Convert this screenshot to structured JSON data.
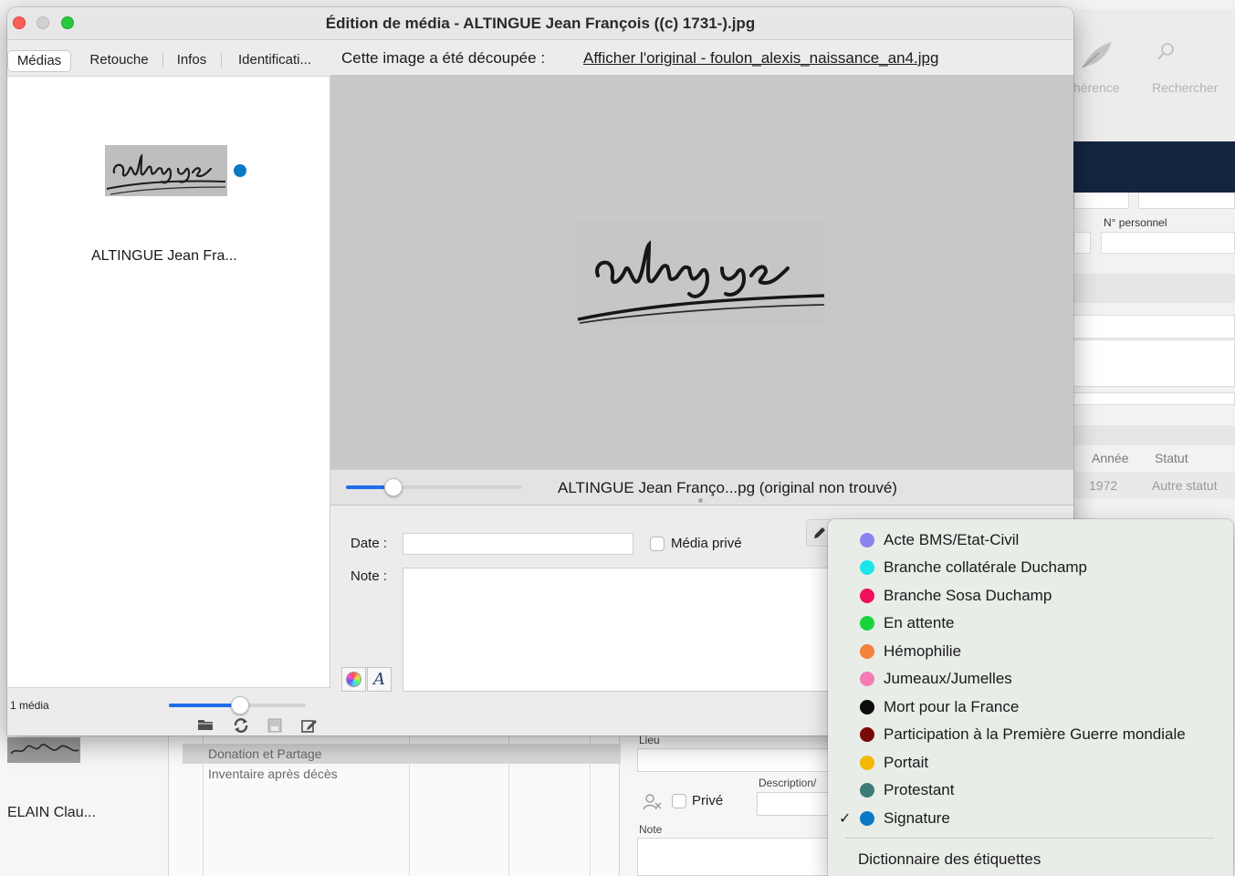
{
  "window": {
    "title": "Édition de média - ALTINGUE Jean François ((c) 1731-).jpg"
  },
  "tabs": [
    "Médias",
    "Retouche",
    "Infos",
    "Identificati..."
  ],
  "left_panel": {
    "thumbnail_name": "ALTINGUE Jean Fra...",
    "media_count": "1 média",
    "zoom_fraction": 0.52
  },
  "crop": {
    "label": "Cette image a été découpée :",
    "link": "Afficher l'original - foulon_alexis_naissance_an4.jpg"
  },
  "viewer": {
    "caption": "ALTINGUE Jean Franço...pg (original non trouvé)",
    "zoom_fraction": 0.27
  },
  "form": {
    "date_label": "Date :",
    "date_value": "",
    "private_label": "Média privé",
    "note_label": "Note :"
  },
  "tag_menu": {
    "items": [
      {
        "label": "Acte BMS/Etat-Civil",
        "color": "#8a84f0",
        "checked": false
      },
      {
        "label": "Branche collatérale Duchamp",
        "color": "#1ce6ea",
        "checked": false
      },
      {
        "label": "Branche Sosa Duchamp",
        "color": "#f0105c",
        "checked": false
      },
      {
        "label": "En attente",
        "color": "#18d43c",
        "checked": false
      },
      {
        "label": "Hémophilie",
        "color": "#f5813a",
        "checked": false
      },
      {
        "label": "Jumeaux/Jumelles",
        "color": "#f57cb4",
        "checked": false
      },
      {
        "label": "Mort pour la France",
        "color": "#0d0d0d",
        "checked": false
      },
      {
        "label": "Participation à la Première Guerre mondiale",
        "color": "#7a0a0a",
        "checked": false
      },
      {
        "label": "Portait",
        "color": "#f5b800",
        "checked": false
      },
      {
        "label": "Protestant",
        "color": "#3d7a78",
        "checked": false
      },
      {
        "label": "Signature",
        "color": "#0a79c4",
        "checked": true
      }
    ],
    "checkmark": "✓",
    "footer": "Dictionnaire des étiquettes"
  },
  "background": {
    "toolbar_items": [
      "hérence",
      "Rechercher"
    ],
    "field_label": "N° personnel",
    "table_headers": [
      "Année",
      "Statut"
    ],
    "table_row": [
      "1972",
      "Autre statut"
    ],
    "events": [
      "Donation et Partage",
      "Inventaire après décès"
    ],
    "left_name": "ELAIN Clau...",
    "lieu_label": "Lieu",
    "description_label": "Description/",
    "private_label": "Privé",
    "note_label": "Note"
  }
}
